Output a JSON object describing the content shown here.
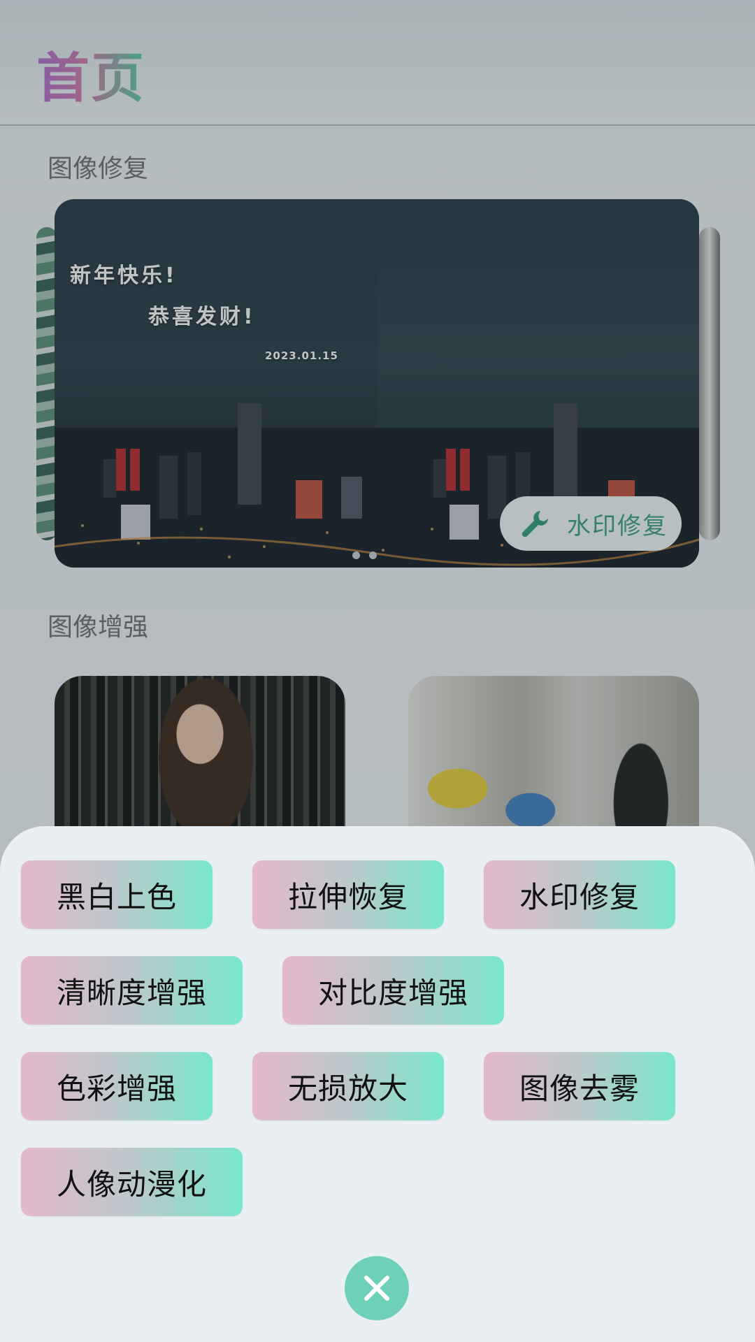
{
  "header": {
    "title": "首页"
  },
  "sections": {
    "repair_title": "图像修复",
    "enhance_title": "图像增强"
  },
  "banner": {
    "line1": "新年快乐!",
    "line2": "恭喜发财!",
    "date": "2023.01.15",
    "chip_label": "水印修复",
    "chip_icon": "wrench-icon",
    "page_count": 2
  },
  "sheet": {
    "tags": [
      "黑白上色",
      "拉伸恢复",
      "水印修复",
      "清晰度增强",
      "对比度增强",
      "色彩增强",
      "无损放大",
      "图像去雾",
      "人像动漫化"
    ],
    "close_icon": "close-icon"
  },
  "colors": {
    "accent": "#3a9e83",
    "close_button": "#6fd0b9",
    "tag_gradient_start": "#e4b7cc",
    "tag_gradient_end": "#79e6cd"
  }
}
